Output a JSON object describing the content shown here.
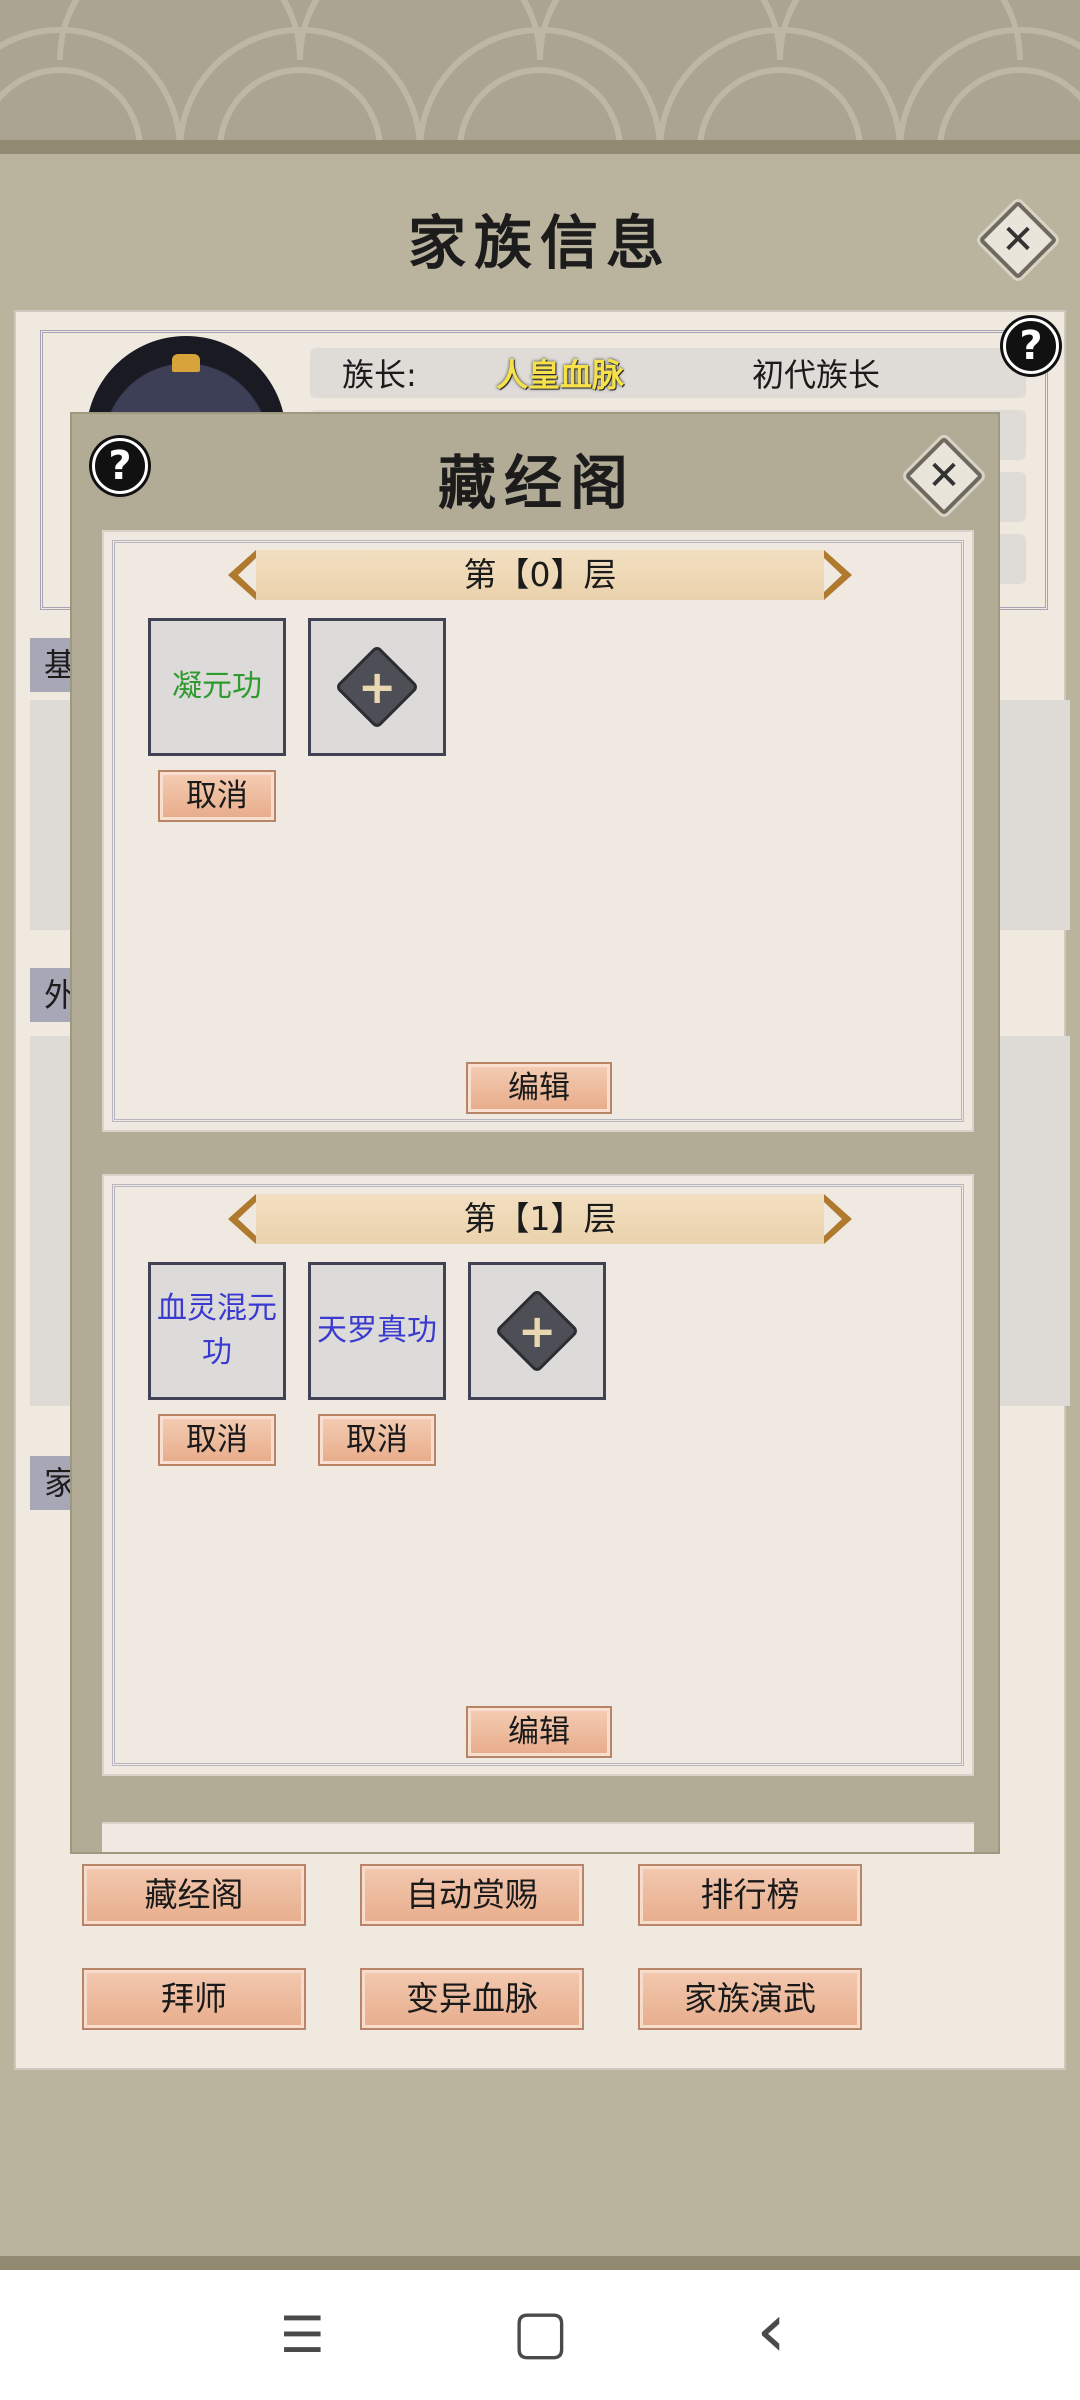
{
  "page": {
    "title": "家族信息",
    "close_label": "✕",
    "help_label": "?"
  },
  "family_info": {
    "leader_label": "族长:",
    "leader_value": "人皇血脉",
    "leader_title": "初代族长",
    "side_tabs": [
      "基",
      "外",
      "家"
    ]
  },
  "bottom_buttons": {
    "row1": [
      "藏经阁",
      "自动赏赐",
      "排行榜"
    ],
    "row2": [
      "拜师",
      "变异血脉",
      "家族演武"
    ]
  },
  "modal": {
    "title": "藏经阁",
    "help_label": "?",
    "close_label": "✕",
    "layers": [
      {
        "header": "第【0】层",
        "skills": [
          {
            "name": "凝元功",
            "color": "#2f9a2f",
            "cancel_label": "取消"
          }
        ],
        "edit_label": "编辑"
      },
      {
        "header": "第【1】层",
        "skills": [
          {
            "name": "血灵混元功",
            "color": "#3a3ad0",
            "cancel_label": "取消"
          },
          {
            "name": "天罗真功",
            "color": "#3a3ad0",
            "cancel_label": "取消"
          }
        ],
        "edit_label": "编辑"
      }
    ],
    "add_icon": "plus-icon"
  },
  "nav": {
    "menu_icon": "☰",
    "home_icon": "▢",
    "back_icon": "‹"
  }
}
